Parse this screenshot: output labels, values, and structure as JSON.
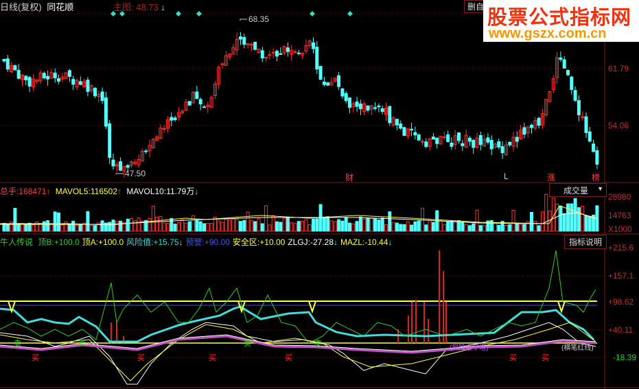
{
  "header": {
    "period": "日线(复权)",
    "stock_name": "同花顺",
    "main_label": "主图:",
    "main_value": "48.73",
    "main_arrow": "↓"
  },
  "watermark": {
    "title": "股票公式指标网",
    "url": "www.gszx.com.cn"
  },
  "self_select_button": "删自选",
  "price_axis": {
    "high_label": "68.35",
    "low_label": "47.50",
    "tick1": "61.79",
    "tick2": "54.06"
  },
  "markers": {
    "cai": "财",
    "L": "L",
    "zhang": "涨",
    "bang": "榜"
  },
  "volume_panel": {
    "total_label": "总手:",
    "total_value": "168471",
    "total_arrow": "↑",
    "mavol5_label": "MAVOL5:",
    "mavol5_value": "116502",
    "mavol5_arrow": "↑",
    "mavol10_label": "MAVOL10:",
    "mavol10_value": "11.79万",
    "mavol10_arrow": "↓",
    "dropdown": "成交量",
    "dropdown_arrow": "▼",
    "axis": [
      "28980",
      "14763",
      "X1000"
    ]
  },
  "indicator_panel": {
    "name": "牛人传说",
    "items": [
      {
        "label": "顶B:",
        "value": "+100.0",
        "arrow": "",
        "color": "#33cc33"
      },
      {
        "label": "顶A:",
        "value": "+100.0",
        "arrow": "",
        "color": "#ffff44"
      },
      {
        "label": "风险值:",
        "value": "+15.75",
        "arrow": "↓",
        "color": "#44dddd"
      },
      {
        "label": "预警:",
        "value": "+90.00",
        "arrow": "",
        "color": "#4455ee"
      },
      {
        "label": "安全区:",
        "value": "+10.00",
        "arrow": "",
        "color": "#ffff44"
      },
      {
        "label": "ZLGJ:",
        "value": "-27.28",
        "arrow": "↓",
        "color": "#ffffff"
      },
      {
        "label": "MAZL:",
        "value": "-10.44",
        "arrow": "↓",
        "color": "#ffff44"
      }
    ],
    "explain_button": "指标说明",
    "axis": [
      "+215.6",
      "+157.1",
      "+98.62",
      "+40.11",
      "-18.39"
    ],
    "signals": {
      "buy": "买",
      "sell": "卖",
      "text1": "(风险金字塔)",
      "text2": "(横笔红线)"
    }
  },
  "colors": {
    "up": "#ff3232",
    "down": "#54ffff",
    "grid": "#7a1818"
  }
}
